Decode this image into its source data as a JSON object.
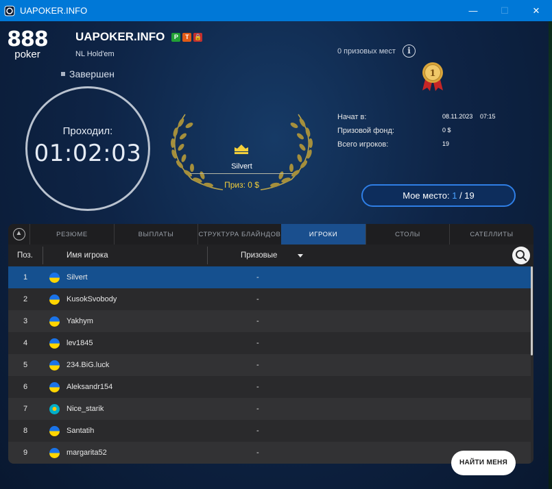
{
  "window": {
    "title": "UAPOKER.INFO",
    "minimize": "—",
    "maximize": "☐",
    "close": "✕"
  },
  "brand": {
    "logo_top": "888",
    "logo_bottom": "poker"
  },
  "tournament": {
    "name": "UAPOKER.INFO",
    "badges": [
      "P",
      "T",
      "🔒"
    ],
    "game": "NL Hold'em",
    "status": "Завершен",
    "clock_label": "Проходил:",
    "clock_time": "01:02:03",
    "prize_places": "0 призовых мест",
    "info_icon": "i",
    "medal_number": "1"
  },
  "winner": {
    "name": "Silvert",
    "prize": "Приз: 0 $"
  },
  "stats": {
    "started_label": "Начат в:",
    "started_date": "08.11.2023",
    "started_time": "07:15",
    "pool_label": "Призовой фонд:",
    "pool_value": "0 $",
    "players_label": "Всего игроков:",
    "players_value": "19"
  },
  "my_place": {
    "label": "Мое место:",
    "rank": "1",
    "sep": " / ",
    "total": "19"
  },
  "tabs": [
    "РЕЗЮМЕ",
    "ВЫПЛАТЫ",
    "СТРУКТУРА БЛАЙНДОВ",
    "ИГРОКИ",
    "СТОЛЫ",
    "САТЕЛЛИТЫ"
  ],
  "active_tab": "ИГРОКИ",
  "table": {
    "headers": {
      "pos": "Поз.",
      "name": "Имя игрока",
      "prize": "Призовые"
    },
    "rows": [
      {
        "pos": "1",
        "name": "Silvert",
        "prize": "-",
        "flag": "ukraine"
      },
      {
        "pos": "2",
        "name": "KusokSvobody",
        "prize": "-",
        "flag": "ukraine"
      },
      {
        "pos": "3",
        "name": "Yakhym",
        "prize": "-",
        "flag": "ukraine"
      },
      {
        "pos": "4",
        "name": "lev1845",
        "prize": "-",
        "flag": "ukraine"
      },
      {
        "pos": "5",
        "name": "234.BiG.luck",
        "prize": "-",
        "flag": "ukraine"
      },
      {
        "pos": "6",
        "name": "Aleksandr154",
        "prize": "-",
        "flag": "ukraine"
      },
      {
        "pos": "7",
        "name": "Nice_starik",
        "prize": "-",
        "flag": "kazakhstan"
      },
      {
        "pos": "8",
        "name": "Santatih",
        "prize": "-",
        "flag": "ukraine"
      },
      {
        "pos": "9",
        "name": "margarita52",
        "prize": "-",
        "flag": "ukraine"
      }
    ]
  },
  "find_me": "НАЙТИ МЕНЯ",
  "colors": {
    "titlebar": "#0078d7",
    "accent_blue": "#2f7fe6",
    "selected_row": "#15508f",
    "gold": "#f3cf3b"
  }
}
